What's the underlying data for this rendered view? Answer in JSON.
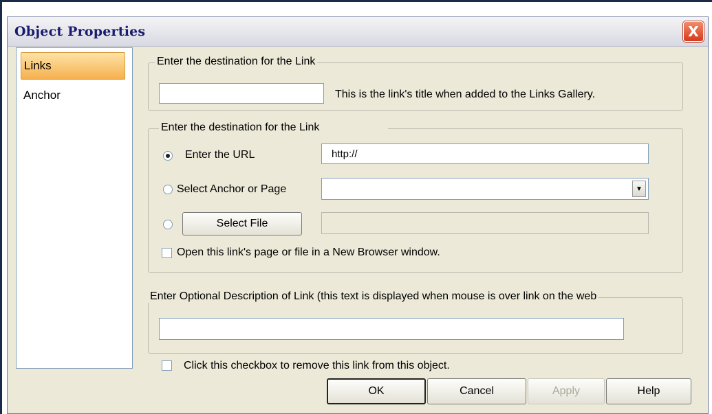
{
  "window": {
    "title": "Object Properties",
    "close_label": "X"
  },
  "sidebar": {
    "items": [
      {
        "label": "Links"
      },
      {
        "label": "Anchor"
      }
    ]
  },
  "title_group": {
    "legend": "Enter the destination for the Link",
    "input_value": "",
    "hint": "This is the link's title when added to the Links Gallery."
  },
  "destination_group": {
    "legend": "Enter the destination for the Link",
    "url_option": {
      "label": "Enter the URL",
      "value": "http://",
      "selected": true
    },
    "anchor_option": {
      "label": "Select Anchor or Page",
      "value": "",
      "selected": false
    },
    "file_option": {
      "button_label": "Select File",
      "value": "",
      "selected": false
    },
    "new_window": {
      "label": "Open this link's page or file in a New Browser window.",
      "checked": false
    }
  },
  "description_group": {
    "legend": "Enter Optional Description of Link (this text is displayed when mouse is over link on the web",
    "input_value": ""
  },
  "remove_link": {
    "label": "Click this checkbox to remove this link from this object.",
    "checked": false
  },
  "footer": {
    "ok": "OK",
    "cancel": "Cancel",
    "apply": "Apply",
    "help": "Help"
  },
  "icons": {
    "dropdown": "chevron-down-icon",
    "close": "close-icon"
  }
}
